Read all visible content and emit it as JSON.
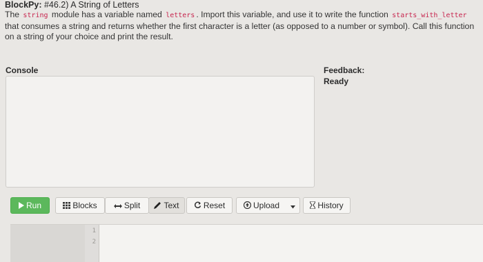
{
  "header": {
    "brand": "BlockPy:",
    "title": " #46.2) A String of Letters"
  },
  "instructions": {
    "part1": "The ",
    "code1": "string",
    "part2": " module has a variable named ",
    "code2": "letters",
    "part3": ". Import this variable, and use it to write the function ",
    "code3": "starts_with_letter",
    "part4": " that consumes a string and returns whether the first character is a letter (as opposed to a number or symbol). Call this function on a string of your choice and print the result."
  },
  "console": {
    "label": "Console"
  },
  "feedback": {
    "label": "Feedback:",
    "status": "Ready"
  },
  "toolbar": {
    "run_label": "Run",
    "blocks_label": "Blocks",
    "split_label": "Split",
    "text_label": "Text",
    "reset_label": "Reset",
    "upload_label": "Upload",
    "history_label": "History"
  },
  "editor": {
    "line_numbers": [
      "1",
      "2"
    ]
  },
  "colors": {
    "run_button": "#5cb85c",
    "code_text": "#c7254e",
    "background": "#e9e7e4"
  },
  "icons": {
    "run": "play-icon",
    "blocks": "grid-icon",
    "split": "split-arrows-icon",
    "text": "pencil-icon",
    "reset": "refresh-icon",
    "upload": "upload-icon",
    "caret": "caret-down-icon",
    "history": "hourglass-icon"
  }
}
